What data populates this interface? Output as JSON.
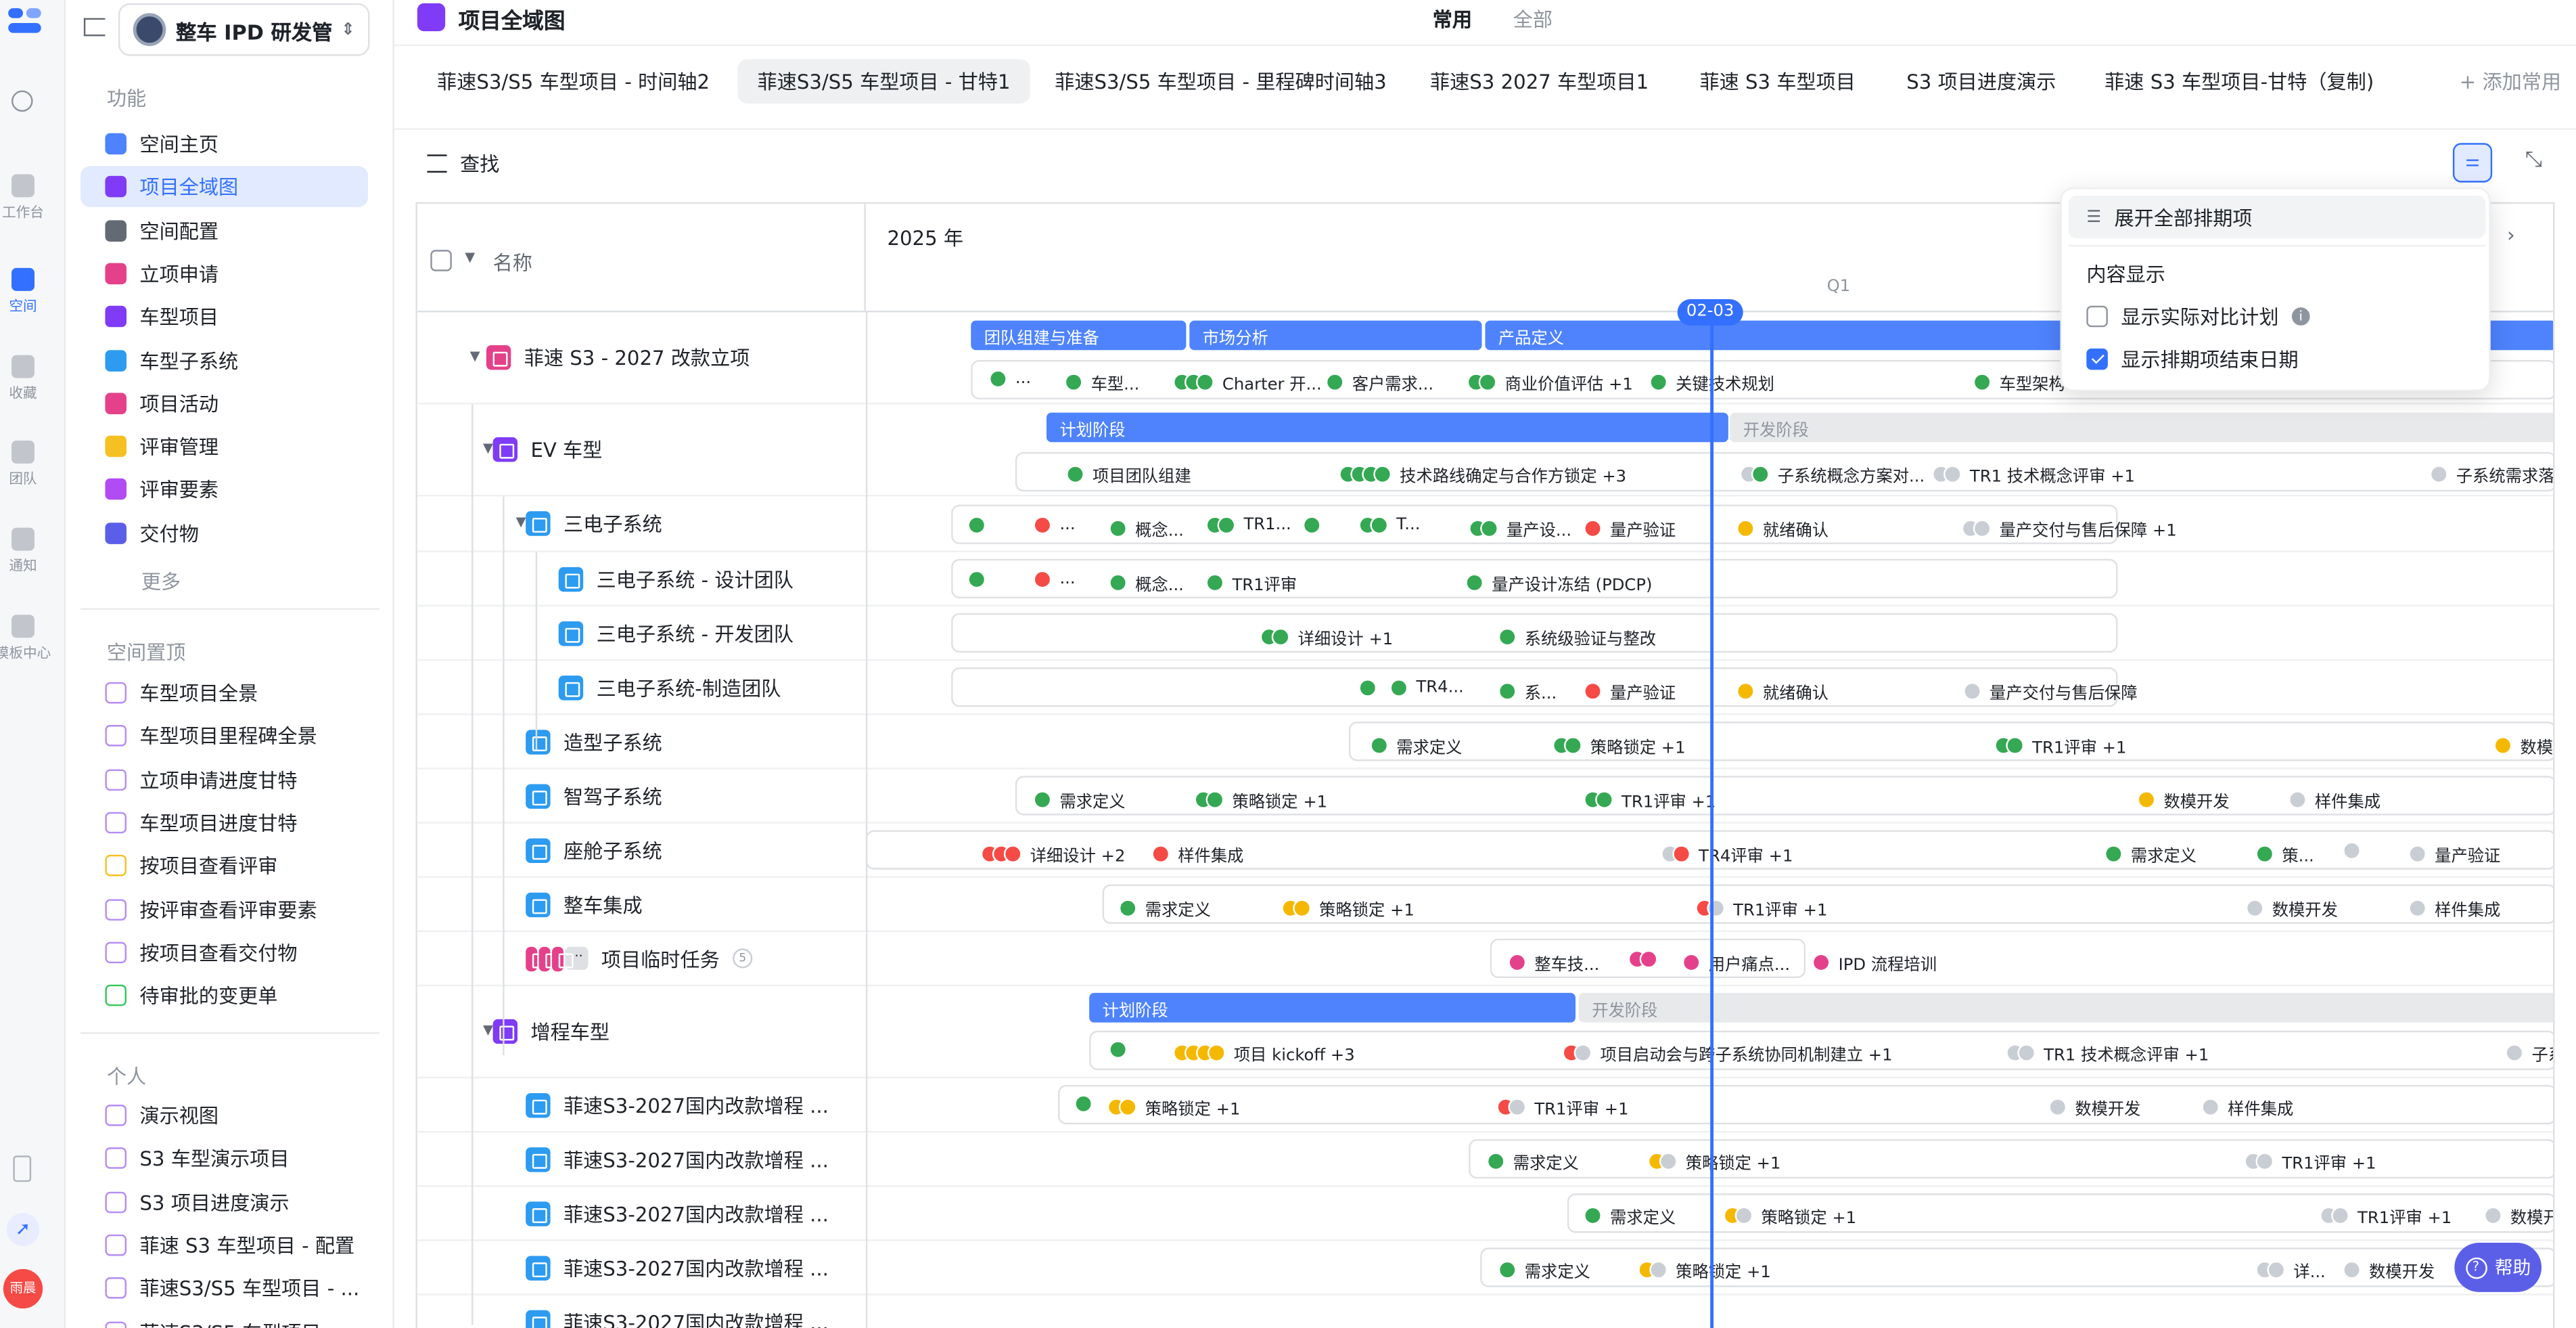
{
  "rail": {
    "items": [
      {
        "label": "工作台"
      },
      {
        "label": "空间"
      },
      {
        "label": "收藏"
      },
      {
        "label": "团队"
      },
      {
        "label": "通知"
      },
      {
        "label": "模板中心"
      }
    ],
    "avatar": "雨晨"
  },
  "sidebar": {
    "workspace": "整车 IPD 研发管...",
    "section_function": "功能",
    "items": [
      {
        "label": "空间主页",
        "color": "#4e83fd"
      },
      {
        "label": "项目全域图",
        "color": "#7f3bf5"
      },
      {
        "label": "空间配置",
        "color": "#646a73"
      },
      {
        "label": "立项申请",
        "color": "#e5418a"
      },
      {
        "label": "车型项目",
        "color": "#7f3bf5"
      },
      {
        "label": "车型子系统",
        "color": "#2d9bf0"
      },
      {
        "label": "项目活动",
        "color": "#e5418a"
      },
      {
        "label": "评审管理",
        "color": "#f5c022"
      },
      {
        "label": "评审要素",
        "color": "#b14cf5"
      },
      {
        "label": "交付物",
        "color": "#5b5fe8"
      }
    ],
    "more": "更多",
    "section_pinned": "空间置顶",
    "pinned": [
      {
        "label": "车型项目全景",
        "color": "#b58cf5"
      },
      {
        "label": "车型项目里程碑全景",
        "color": "#b58cf5"
      },
      {
        "label": "立项申请进度甘特",
        "color": "#b58cf5"
      },
      {
        "label": "车型项目进度甘特",
        "color": "#b58cf5"
      },
      {
        "label": "按项目查看评审",
        "color": "#f5c022"
      },
      {
        "label": "按评审查看评审要素",
        "color": "#b58cf5"
      },
      {
        "label": "按项目查看交付物",
        "color": "#b58cf5"
      },
      {
        "label": "待审批的变更单",
        "color": "#34c759"
      }
    ],
    "section_personal": "个人",
    "personal": [
      {
        "label": "演示视图"
      },
      {
        "label": "S3 车型演示项目"
      },
      {
        "label": "S3 项目进度演示"
      },
      {
        "label": "菲速 S3 车型项目 - 配置"
      },
      {
        "label": "菲速S3/S5 车型项目 - ..."
      },
      {
        "label": "菲速S3/S5 车型项目 ..."
      }
    ]
  },
  "header": {
    "title": "项目全域图",
    "seg_common": "常用",
    "seg_all": "全部"
  },
  "tabs": [
    {
      "label": "菲速S3/S5 车型项目 - 时间轴2"
    },
    {
      "label": "菲速S3/S5 车型项目 - 甘特1"
    },
    {
      "label": "菲速S3/S5 车型项目 - 里程碑时间轴3"
    },
    {
      "label": "菲速S3 2027 车型项目1"
    },
    {
      "label": "菲速 S3 车型项目"
    },
    {
      "label": "S3 项目进度演示"
    },
    {
      "label": "菲速 S3 车型项目-甘特（复制)"
    }
  ],
  "add_tab": "+ 添加常用",
  "toolbar": {
    "find": "查找"
  },
  "gantt": {
    "name_header": "名称",
    "year": "2025 年",
    "quarter": "Q1",
    "today": "02-03"
  },
  "rows": [
    {
      "name": "菲速 S3 - 2027 改款立项",
      "color": "#e5418a"
    },
    {
      "name": "EV 车型",
      "color": "#7f3bf5"
    },
    {
      "name": "三电子系统",
      "color": "#2d9bf0"
    },
    {
      "name": "三电子系统 - 设计团队",
      "color": "#2d9bf0"
    },
    {
      "name": "三电子系统 - 开发团队",
      "color": "#2d9bf0"
    },
    {
      "name": "三电子系统-制造团队",
      "color": "#2d9bf0"
    },
    {
      "name": "造型子系统",
      "color": "#2d9bf0"
    },
    {
      "name": "智驾子系统",
      "color": "#2d9bf0"
    },
    {
      "name": "座舱子系统",
      "color": "#2d9bf0"
    },
    {
      "name": "整车集成",
      "color": "#2d9bf0"
    },
    {
      "name": "项目临时任务",
      "color": "#e5418a",
      "badge": "5"
    },
    {
      "name": "增程车型",
      "color": "#7f3bf5"
    },
    {
      "name": "菲速S3-2027国内改款增程 ...",
      "color": "#2d9bf0"
    },
    {
      "name": "菲速S3-2027国内改款增程 ...",
      "color": "#2d9bf0"
    },
    {
      "name": "菲速S3-2027国内改款增程 ...",
      "color": "#2d9bf0"
    },
    {
      "name": "菲速S3-2027国内改款增程 ...",
      "color": "#2d9bf0"
    },
    {
      "name": "菲速S3-2027国内改款增程 ...",
      "color": "#2d9bf0"
    }
  ],
  "bars": {
    "r0": [
      "团队组建与准备",
      "市场分析",
      "产品定义"
    ],
    "r1": [
      "计划阶段",
      "开发阶段"
    ],
    "r11": [
      "计划阶段",
      "开发阶段"
    ]
  },
  "milestones": {
    "r0": [
      "...",
      "车型...",
      "Charter 开...",
      "客户需求...",
      "商业价值评估 +1",
      "关键技术规划",
      "车型架构"
    ],
    "r1": [
      "项目团队组建",
      "技术路线确定与合作方锁定 +3",
      "子系统概念方案对...",
      "TR1 技术概念评审 +1",
      "子系统需求落地"
    ],
    "r2": [
      "...",
      "概念...",
      "TR1...",
      "T...",
      "量产设...",
      "量产验证",
      "就绪确认",
      "量产交付与售后保障 +1"
    ],
    "r3": [
      "...",
      "概念...",
      "TR1评审",
      "量产设计冻结 (PDCP)"
    ],
    "r4": [
      "详细设计 +1",
      "系统级验证与整改"
    ],
    "r5": [
      "TR4...",
      "系...",
      "量产验证",
      "就绪确认",
      "量产交付与售后保障"
    ],
    "r6": [
      "需求定义",
      "策略锁定 +1",
      "TR1评审 +1",
      "数模开"
    ],
    "r7": [
      "需求定义",
      "策略锁定 +1",
      "TR1评审 +1",
      "数模开发",
      "样件集成"
    ],
    "r8": [
      "详细设计 +2",
      "样件集成",
      "TR4评审 +1",
      "需求定义",
      "策...",
      "量产验证"
    ],
    "r9": [
      "需求定义",
      "策略锁定 +1",
      "TR1评审 +1",
      "数模开发",
      "样件集成"
    ],
    "r10": [
      "整车技...",
      "用户痛点...",
      "IPD 流程培训"
    ],
    "r11": [
      "项目 kickoff +3",
      "项目启动会与跨子系统协同机制建立 +1",
      "TR1 技术概念评审 +1",
      "子系"
    ],
    "r12": [
      "策略锁定 +1",
      "TR1评审 +1",
      "数模开发",
      "样件集成"
    ],
    "r13": [
      "需求定义",
      "策略锁定 +1",
      "TR1评审 +1"
    ],
    "r14": [
      "需求定义",
      "策略锁定 +1",
      "TR1评审 +1",
      "数模开"
    ],
    "r15": [
      "需求定义",
      "策略锁定 +1",
      "详...",
      "数模开发"
    ]
  },
  "popover": {
    "expand_all": "展开全部排期项",
    "content_title": "内容显示",
    "opt_compare": "显示实际对比计划",
    "opt_end_date": "显示排期项结束日期",
    "opt_compare_checked": false,
    "opt_end_date_checked": true
  },
  "help": "帮助",
  "colors": {
    "accent": "#3370ff",
    "bar_blue": "#4e83fd",
    "bar_gray": "#e4e5e7",
    "done": "#34a853",
    "warn": "#f5b800",
    "gray": "#c9cdd4",
    "red": "#f54a45"
  }
}
